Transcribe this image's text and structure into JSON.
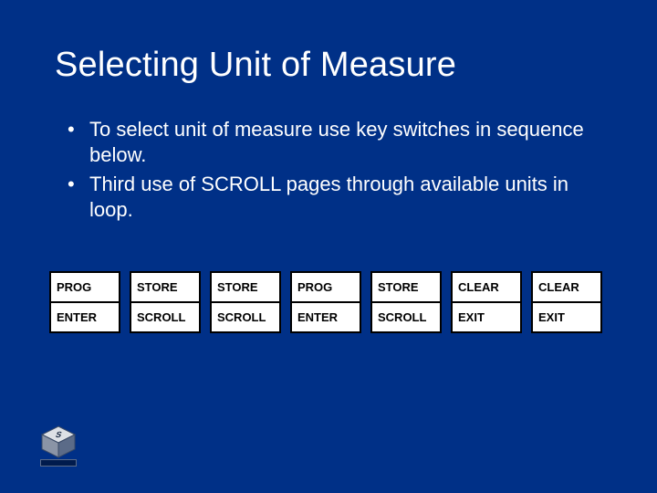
{
  "title": "Selecting Unit of Measure",
  "bullets": [
    "To select unit of measure use key switches in sequence below.",
    "Third use of SCROLL pages through available units in loop."
  ],
  "keys": [
    {
      "top": "PROG",
      "bottom": "ENTER"
    },
    {
      "top": "STORE",
      "bottom": "SCROLL"
    },
    {
      "top": "STORE",
      "bottom": "SCROLL"
    },
    {
      "top": "PROG",
      "bottom": "ENTER"
    },
    {
      "top": "STORE",
      "bottom": "SCROLL"
    },
    {
      "top": "CLEAR",
      "bottom": "EXIT"
    },
    {
      "top": "CLEAR",
      "bottom": "EXIT"
    }
  ]
}
